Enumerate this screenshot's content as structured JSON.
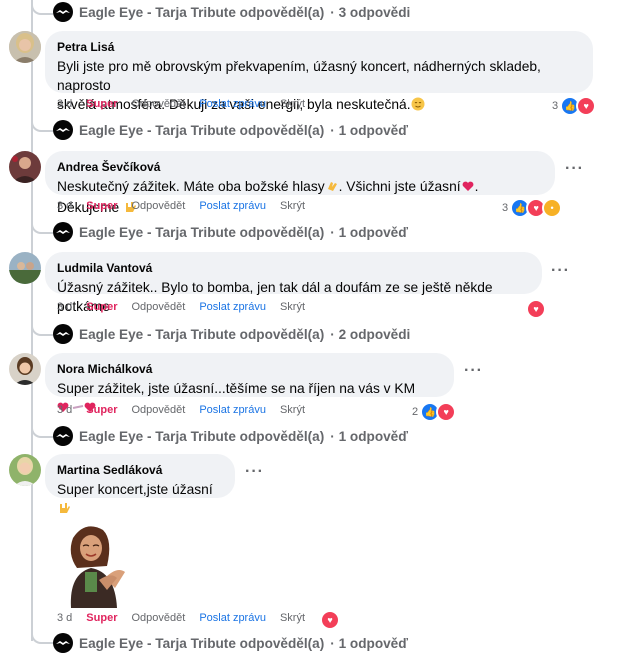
{
  "thread_rows": [
    {
      "name": "Eagle Eye - Tarja Tribute odpověděl(a)",
      "count": "· 3 odpovědi"
    },
    {
      "name": "Eagle Eye - Tarja Tribute odpověděl(a)",
      "count": "· 1 odpověď"
    },
    {
      "name": "Eagle Eye - Tarja Tribute odpověděl(a)",
      "count": "· 1 odpověď"
    },
    {
      "name": "Eagle Eye - Tarja Tribute odpověděl(a)",
      "count": "· 2 odpovědi"
    },
    {
      "name": "Eagle Eye - Tarja Tribute odpověděl(a)",
      "count": "· 1 odpověď"
    },
    {
      "name": "Eagle Eye - Tarja Tribute odpověděl(a)",
      "count": "· 1 odpověď"
    }
  ],
  "actions": {
    "age": "3 d",
    "super": "Super",
    "reply": "Odpovědět",
    "send": "Poslat zprávu",
    "hide": "Skrýt"
  },
  "comments": [
    {
      "author": "Petra Lisá",
      "line1": "Byli jste pro mě obrovským překvapením, úžasný koncert, nádherných skladeb, naprosto",
      "line2": "skvělá atmosféra. Děkuji za vaši energii, byla neskutečná.",
      "reaction_count": "3"
    },
    {
      "author": "Andrea Ševčíková",
      "line1a": "Neskutečný zážitek. Máte oba božské hlasy",
      "line1b": ". Všichni jste úžasní",
      "line1c": ". Děkujeme",
      "reaction_count": "3"
    },
    {
      "author": "Ludmila Vantová",
      "line1": "Úžasný zážitek.. Bylo to bomba, jen tak dál a doufám ze se ještě někde potkáme",
      "reaction_count": ""
    },
    {
      "author": "Nora Michálková",
      "line1": "Super zážitek, jste úžasní...těšíme se na říjen na vás v KM",
      "reaction_count": "2"
    },
    {
      "author": "Martina Sedláková",
      "line1": "Super koncert,jste úžasní",
      "reaction_count": ""
    }
  ],
  "colors": {
    "super": "#e0245e",
    "link": "#1b74e4",
    "bubble": "#f0f2f5",
    "muted": "#65676b"
  }
}
